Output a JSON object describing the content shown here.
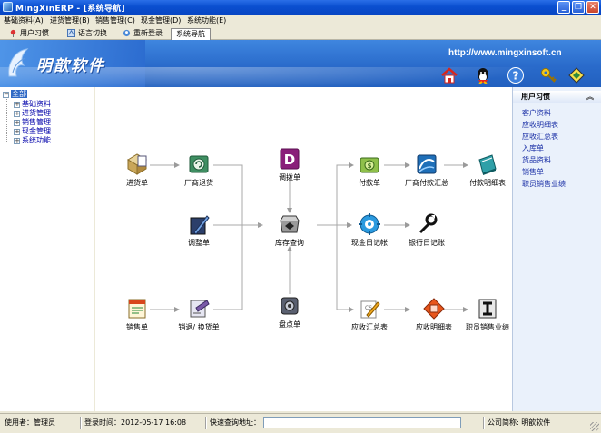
{
  "window": {
    "title": "MingXinERP - [系统导航]",
    "controls": [
      "minimize-icon",
      "restore-icon",
      "close-icon"
    ]
  },
  "menubar": {
    "items": [
      {
        "label": "基础资料(A)"
      },
      {
        "label": "进货管理(B)"
      },
      {
        "label": "销售管理(C)"
      },
      {
        "label": "现金管理(D)"
      },
      {
        "label": "系统功能(E)"
      }
    ]
  },
  "tabs": [
    {
      "label": "用户习惯",
      "icon": "pin-icon"
    },
    {
      "label": "语言切换",
      "icon": "language-icon"
    },
    {
      "label": "重新登录",
      "icon": "relogin-icon"
    },
    {
      "label": "系统导航",
      "active": true
    }
  ],
  "banner": {
    "brand": "明歆软件",
    "url": "http://www.mingxinsoft.cn",
    "icons": [
      "home-icon",
      "qq-icon",
      "help-icon",
      "key-icon",
      "diamond-icon"
    ]
  },
  "tree": {
    "root": "全部",
    "items": [
      {
        "label": "基础资料"
      },
      {
        "label": "进货管理"
      },
      {
        "label": "销售管理"
      },
      {
        "label": "现金管理"
      },
      {
        "label": "系统功能"
      }
    ]
  },
  "flow": {
    "nodes": {
      "purchase_order": "进货单",
      "supplier_return": "厂商退货",
      "transfer_order": "调拨单",
      "adjust_order": "调整单",
      "inventory_query": "库存查询",
      "stock_count": "盘点单",
      "sales_order": "销售单",
      "sales_return": "销退/ 换货单",
      "payment_order": "付款单",
      "supplier_payment_summary": "厂商付款汇总",
      "payment_detail": "付款明细表",
      "cash_journal": "现金日记帐",
      "bank_journal": "银行日记账",
      "receivable_summary": "应收汇总表",
      "receivable_detail": "应收明细表",
      "staff_sales": "职员销售业绩"
    }
  },
  "right_panel": {
    "title": "用户习惯",
    "collapse": "︽",
    "links": [
      {
        "label": "客户资料"
      },
      {
        "label": "应收明细表"
      },
      {
        "label": "应收汇总表"
      },
      {
        "label": "入库单"
      },
      {
        "label": "货品资料"
      },
      {
        "label": "销售单"
      },
      {
        "label": "职员销售业绩"
      }
    ]
  },
  "statusbar": {
    "user": "使用者：管理员",
    "login_time": "登录时间：2012-05-17 16:08",
    "quick_label": "快速查询地址：",
    "quick_value": "",
    "company": "公司简称: 明歆软件"
  },
  "colors": {
    "titlebar": "#0a4fd0",
    "banner": "#2a6bcb",
    "link": "#1a2fa6",
    "connector": "#a0a0a0"
  }
}
